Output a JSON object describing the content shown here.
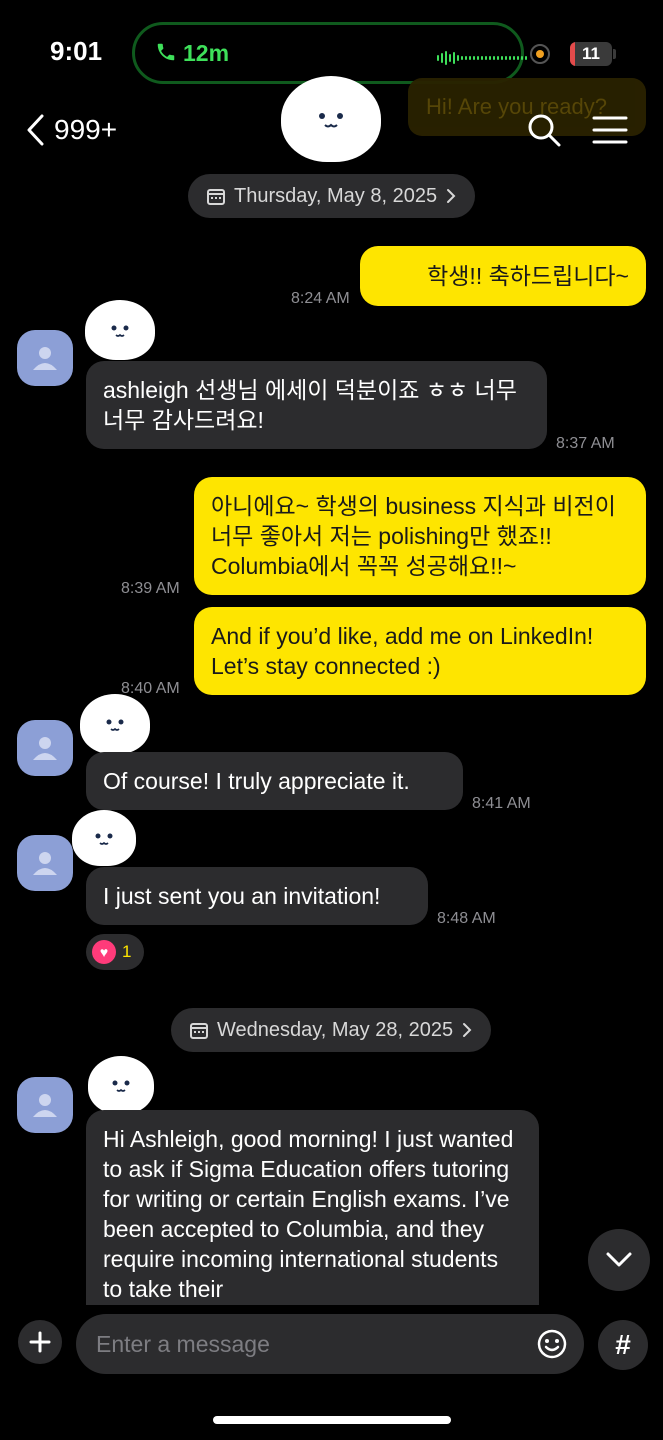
{
  "status_bar": {
    "time": "9:01",
    "call_duration": "12m",
    "battery_level": "11"
  },
  "ghost_notification": "Hi! Are you ready?",
  "header": {
    "back_count": "999+"
  },
  "date_separators": [
    "Thursday, May 8, 2025",
    "Wednesday, May 28, 2025"
  ],
  "messages": [
    {
      "side": "out",
      "text": "학생!! 축하드립니다~",
      "time": "8:24 AM"
    },
    {
      "side": "in",
      "text": "ashleigh 선생님 에세이 덕분이죠 ㅎㅎ 너무 너무 감사드려요!",
      "time": "8:37 AM"
    },
    {
      "side": "out",
      "text": "아니에요~ 학생의 business 지식과 비전이 너무 좋아서 저는 polishing만 했죠!! Columbia에서 꼭꼭 성공해요!!~",
      "time": "8:39 AM"
    },
    {
      "side": "out",
      "text": "And if you’d like, add me on LinkedIn! Let’s stay connected :)",
      "time": "8:40 AM"
    },
    {
      "side": "in",
      "text": "Of course! I truly appreciate it.",
      "time": "8:41 AM"
    },
    {
      "side": "in",
      "text": "I just sent you an invitation!",
      "time": "8:48 AM",
      "reaction_count": "1"
    },
    {
      "side": "in",
      "text": "Hi Ashleigh, good morning! I just wanted to ask if Sigma Education offers tutoring for writing or certain English exams. I’ve been accepted to Columbia, and they require incoming international students to take their"
    }
  ],
  "input": {
    "placeholder": "Enter a message"
  },
  "colors": {
    "outgoing_bubble": "#fee500",
    "incoming_bubble": "#2c2c2e",
    "call_green": "#3ee05a",
    "avatar_blue": "#8c9fd6"
  }
}
